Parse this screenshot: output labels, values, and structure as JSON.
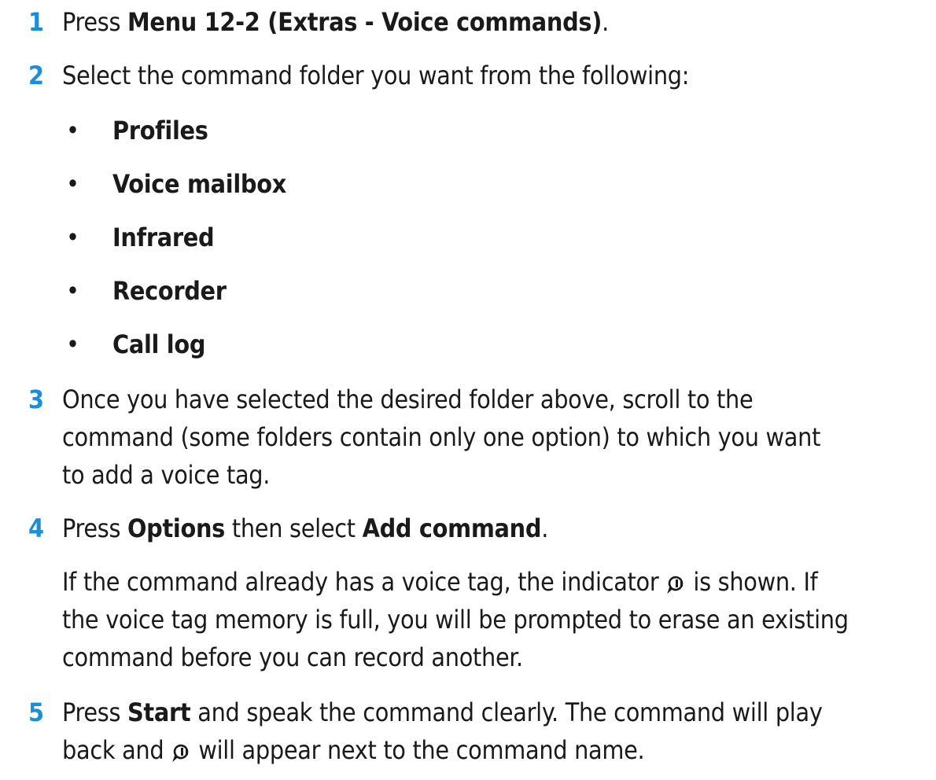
{
  "steps": [
    {
      "num": "1",
      "pre": "Press ",
      "bold": "Menu 12-2 (Extras - Voice commands)",
      "post": "."
    },
    {
      "num": "2",
      "text": "Select the command folder you want from the following:",
      "bullets": [
        "Profiles",
        "Voice mailbox",
        "Infrared",
        "Recorder",
        "Call log"
      ]
    },
    {
      "num": "3",
      "line1": "Once you have selected the desired folder above, scroll to the",
      "line2": "command (some folders contain only one option) to which you want",
      "line3": "to add a voice tag."
    },
    {
      "num": "4",
      "pre": "Press ",
      "bold1": "Options",
      "mid": " then select ",
      "bold2": "Add command",
      "post": ".",
      "note_pre": "If the command already has a voice tag, the indicator",
      "note_post": "is shown. If",
      "note_line2": "the voice tag memory is full, you will be prompted to erase an existing",
      "note_line3": "command before you can record another."
    },
    {
      "num": "5",
      "pre": "Press ",
      "bold": "Start",
      "post": " and speak the command clearly. The command will play",
      "line2_pre": "back and",
      "line2_post": "will appear next to the command name."
    }
  ],
  "icons": {
    "voice_tag": "voice-tag-icon"
  },
  "colors": {
    "step_number": "#1a8fd8",
    "text": "#1a1a1a"
  }
}
